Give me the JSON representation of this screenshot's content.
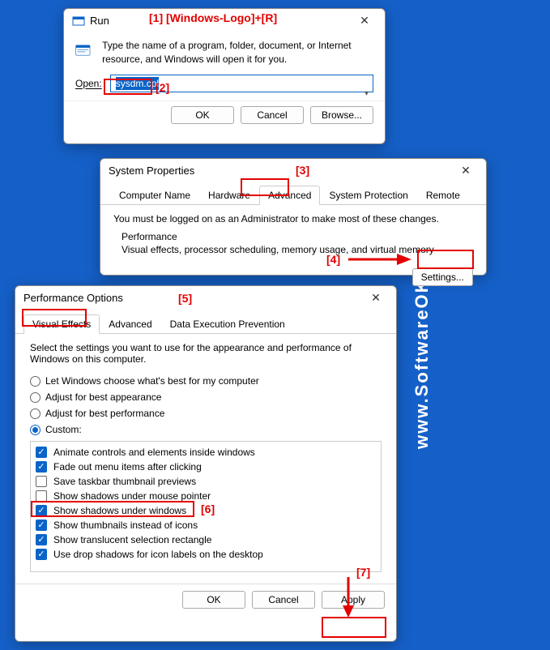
{
  "annotations": {
    "a1": "[1]  [Windows-Logo]+[R]",
    "a2": "[2]",
    "a3": "[3]",
    "a4": "[4]",
    "a5": "[5]",
    "a6": "[6]",
    "a7": "[7]"
  },
  "run": {
    "title": "Run",
    "desc": "Type the name of a program, folder, document, or Internet resource, and Windows will open it for you.",
    "open_label": "Open:",
    "open_value": "sysdm.cpl",
    "ok": "OK",
    "cancel": "Cancel",
    "browse": "Browse..."
  },
  "sysprop": {
    "title": "System Properties",
    "tabs": [
      "Computer Name",
      "Hardware",
      "Advanced",
      "System Protection",
      "Remote"
    ],
    "admin_note": "You must be logged on as an Administrator to make most of these changes.",
    "perf_legend": "Performance",
    "perf_desc": "Visual effects, processor scheduling, memory usage, and virtual memory",
    "settings": "Settings..."
  },
  "perfopt": {
    "title": "Performance Options",
    "tabs": [
      "Visual Effects",
      "Advanced",
      "Data Execution Prevention"
    ],
    "intro": "Select the settings you want to use for the appearance and performance of Windows on this computer.",
    "radios": [
      "Let Windows choose what's best for my computer",
      "Adjust for best appearance",
      "Adjust for best performance",
      "Custom:"
    ],
    "checks": [
      {
        "label": "Animate controls and elements inside windows",
        "checked": true
      },
      {
        "label": "Fade out menu items after clicking",
        "checked": true
      },
      {
        "label": "Save taskbar thumbnail previews",
        "checked": false
      },
      {
        "label": "Show shadows under mouse pointer",
        "checked": false
      },
      {
        "label": "Show shadows under windows",
        "checked": true
      },
      {
        "label": "Show thumbnails instead of icons",
        "checked": true
      },
      {
        "label": "Show translucent selection rectangle",
        "checked": true
      },
      {
        "label": "Use drop shadows for icon labels on the desktop",
        "checked": true
      }
    ],
    "ok": "OK",
    "cancel": "Cancel",
    "apply": "Apply"
  },
  "site": {
    "vertical": "www.SoftwareOK.com :-)",
    "wm": "www.SoftwareOK.com :-)"
  }
}
